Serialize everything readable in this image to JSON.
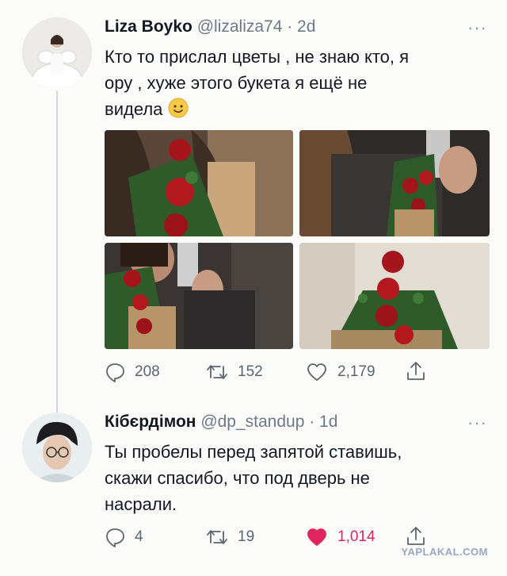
{
  "tweet1": {
    "name": "Liza Boyko",
    "handle": "@lizaliza74 · 2d",
    "more": "···",
    "text": "Кто то прислал цветы , не знаю кто, я\nору , хуже этого букета я ещё не\nвидела",
    "emoji": "smiling-face",
    "replies": "208",
    "retweets": "152",
    "likes": "2,179"
  },
  "tweet2": {
    "name": "Кібєрдімон",
    "handle": "@dp_standup · 1d",
    "more": "···",
    "text": "Ты пробелы перед запятой ставишь,\nскажи спасибо, что под дверь не\nнасрали.",
    "replies": "4",
    "retweets": "19",
    "likes": "1,014",
    "liked": true
  },
  "colors": {
    "like_active": "#e0245e",
    "icon": "#5b6670",
    "watermark": "#9aa8bd"
  },
  "watermark": "YAPLAKAL.COM"
}
